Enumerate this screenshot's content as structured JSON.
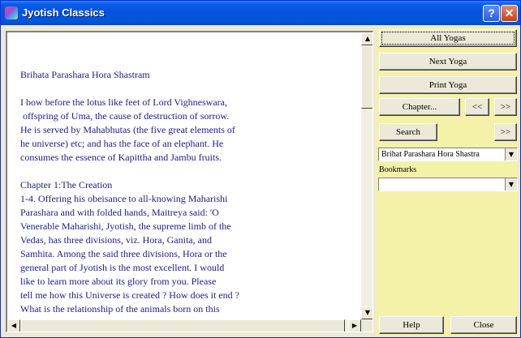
{
  "window": {
    "title": "Jyotish Classics",
    "help_label": "?",
    "close_label": "✕"
  },
  "text_pane": {
    "content": "Brihata Parashara Hora Shastram\n\nI bow before the lotus like feet of Lord Vighneswara,\n offspring of Uma, the cause of destruction of sorrow.\nHe is served by Mahabhutas (the five great elements of\nhe universe) etc; and has the face of an elephant. He\nconsumes the essence of Kapittha and Jambu fruits.\n\nChapter 1:The Creation\n1-4. Offering his obeisance to all-knowing Maharishi\nParashara and with folded hands, Maitreya said: 'O\nVenerable Maharishi, Jyotish, the supreme limb of the\nVedas, has three divisions, viz. Hora, Ganita, and\nSamhita. Among the said three divisions, Hora or the\ngeneral part of Jyotish is the most excellent. I would\nlike to learn more about its glory from you. Please\ntell me how this Universe is created ? How does it end ?\nWhat is the relationship of the animals born on this",
    "scroll_up": "▲",
    "scroll_down": "▼",
    "scroll_left": "◀",
    "scroll_right": "▶"
  },
  "panel": {
    "all_yogas": "All Yogas",
    "next_yoga": "Next Yoga",
    "print_yoga": "Print Yoga",
    "chapter": "Chapter...",
    "prev": "<<",
    "next": ">>",
    "search": "Search",
    "search_next": ">>",
    "book_select": "Brihat Parashara Hora Shastra",
    "bookmarks_label": "Bookmarks",
    "bookmarks_value": "",
    "dropdown_arrow": "▼",
    "help": "Help",
    "close": "Close"
  }
}
